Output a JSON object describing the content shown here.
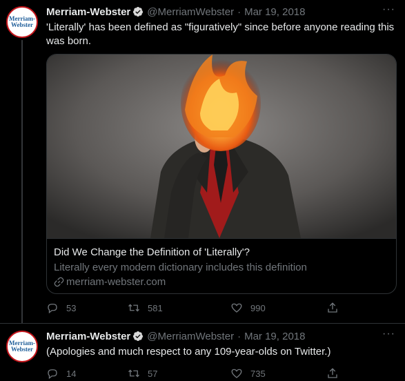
{
  "tweets": [
    {
      "display_name": "Merriam-Webster",
      "handle": "@MerriamWebster",
      "separator": "·",
      "date": "Mar 19, 2018",
      "text": "'Literally' has been defined as \"figuratively\" since before anyone reading this was born.",
      "card": {
        "title": "Did We Change the Definition of 'Literally'?",
        "description": "Literally every modern dictionary includes this definition",
        "domain": "merriam-webster.com"
      },
      "replies": "53",
      "retweets": "581",
      "likes": "990"
    },
    {
      "display_name": "Merriam-Webster",
      "handle": "@MerriamWebster",
      "separator": "·",
      "date": "Mar 19, 2018",
      "text": "(Apologies and much respect to any 109-year-olds on Twitter.)",
      "replies": "14",
      "retweets": "57",
      "likes": "735"
    }
  ],
  "avatar_logo": {
    "line1": "Merriam-",
    "line2": "Webster"
  },
  "more_label": "···",
  "colors": {
    "background": "#000000",
    "verified": "#d9d9d9",
    "secondary_text": "#71767b",
    "border": "#2f3336",
    "logo_red": "#c4161c",
    "logo_blue": "#1f5e9a"
  },
  "icons": [
    "verified-badge-icon",
    "more-icon",
    "link-icon",
    "reply-icon",
    "retweet-icon",
    "like-icon",
    "share-icon"
  ]
}
